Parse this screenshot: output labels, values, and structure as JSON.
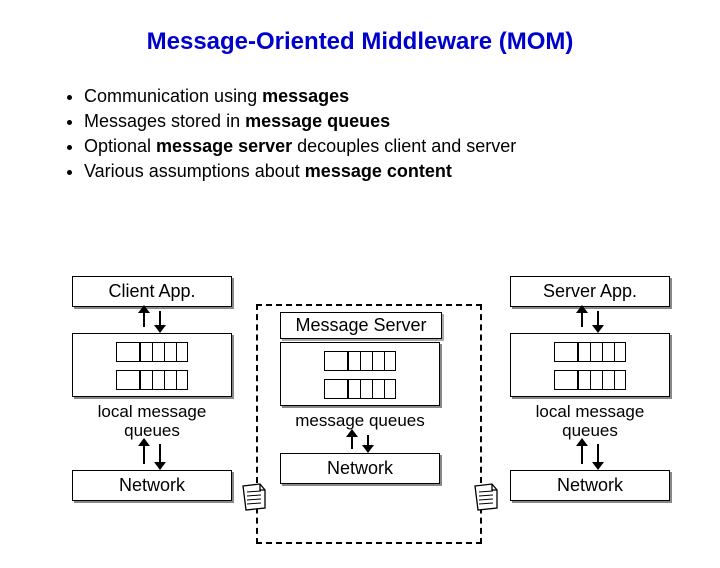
{
  "title": "Message-Oriented Middleware (MOM)",
  "bullets": [
    {
      "pre": "Communication using ",
      "bold": "messages",
      "post": ""
    },
    {
      "pre": "Messages stored in ",
      "bold": "message queues",
      "post": ""
    },
    {
      "pre": "Optional ",
      "bold": "message server",
      "post": " decouples client and server"
    },
    {
      "pre": "Various assumptions about ",
      "bold": "message content",
      "post": ""
    }
  ],
  "diagram": {
    "client": {
      "app": "Client App.",
      "queues": "local message queues",
      "network": "Network"
    },
    "server": {
      "label": "Message Server",
      "queues": "message queues",
      "network": "Network"
    },
    "serverapp": {
      "app": "Server App.",
      "queues": "local message queues",
      "network": "Network"
    }
  }
}
